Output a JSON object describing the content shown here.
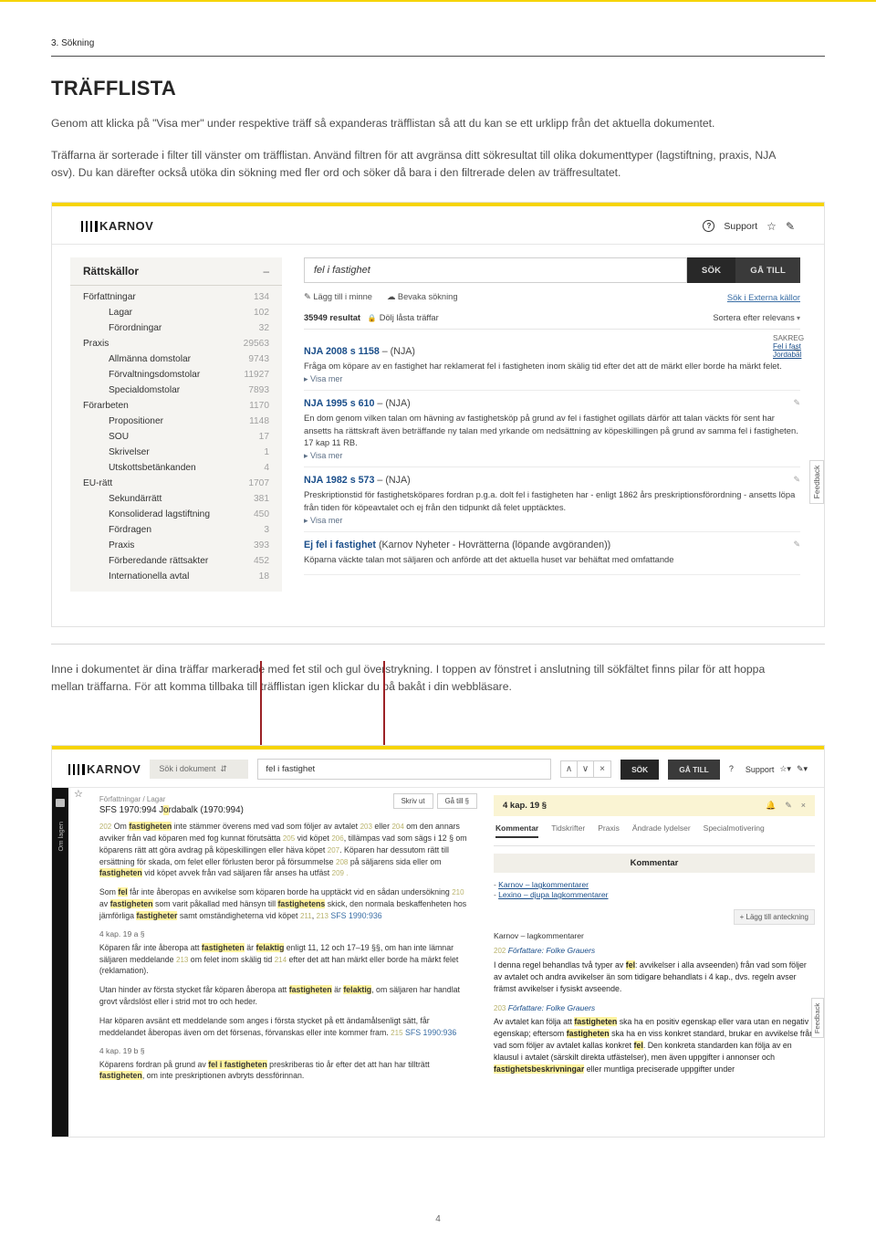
{
  "page": {
    "breadcrumb": "3. Sökning",
    "title": "TRÄFFLISTA",
    "intro1": "Genom att klicka på \"Visa mer\" under respektive träff så expanderas träfflistan så att du kan se ett urklipp från det aktuella dokumentet.",
    "intro2": "Träffarna är sorterade i filter till vänster om träfflistan. Använd filtren för att avgränsa ditt sökresultat till olika dokumenttyper (lagstiftning, praxis, NJA osv). Du kan därefter också utöka din sökning med fler ord och söker då bara i den filtrerade delen av träffresultatet.",
    "intro3": "Inne i dokumentet är dina träffar markerade med fet stil och gul överstrykning. I toppen av fönstret i anslutning till sökfältet finns pilar för att hoppa mellan träffarna. För att komma tillbaka till träfflistan igen klickar du på bakåt i din webbläsare.",
    "page_number": "4"
  },
  "s1": {
    "logo": "KARNOV",
    "support": "Support",
    "side_head": "Rättskällor",
    "side_items": [
      {
        "l": "Författningar",
        "n": "134",
        "sub": false
      },
      {
        "l": "Lagar",
        "n": "102",
        "sub": true
      },
      {
        "l": "Förordningar",
        "n": "32",
        "sub": true
      },
      {
        "l": "Praxis",
        "n": "29563",
        "sub": false
      },
      {
        "l": "Allmänna domstolar",
        "n": "9743",
        "sub": true
      },
      {
        "l": "Förvaltningsdomstolar",
        "n": "11927",
        "sub": true
      },
      {
        "l": "Specialdomstolar",
        "n": "7893",
        "sub": true
      },
      {
        "l": "Förarbeten",
        "n": "1170",
        "sub": false
      },
      {
        "l": "Propositioner",
        "n": "1148",
        "sub": true
      },
      {
        "l": "SOU",
        "n": "17",
        "sub": true
      },
      {
        "l": "Skrivelser",
        "n": "1",
        "sub": true
      },
      {
        "l": "Utskottsbetänkanden",
        "n": "4",
        "sub": true
      },
      {
        "l": "EU-rätt",
        "n": "1707",
        "sub": false
      },
      {
        "l": "Sekundärrätt",
        "n": "381",
        "sub": true
      },
      {
        "l": "Konsoliderad lagstiftning",
        "n": "450",
        "sub": true
      },
      {
        "l": "Fördragen",
        "n": "3",
        "sub": true
      },
      {
        "l": "Praxis",
        "n": "393",
        "sub": true
      },
      {
        "l": "Förberedande rättsakter",
        "n": "452",
        "sub": true
      },
      {
        "l": "Internationella avtal",
        "n": "18",
        "sub": true
      }
    ],
    "query": "fel i fastighet",
    "btn_sok": "SÖK",
    "btn_gatill": "GÅ TILL",
    "link_minne": "Lägg till i minne",
    "link_bevaka": "Bevaka sökning",
    "link_extern": "Sök i Externa källor",
    "result_count": "35949 resultat",
    "hide_locked": "Dölj låsta träffar",
    "sort": "Sortera efter relevans",
    "results": [
      {
        "title": "NJA 2008 s 1158",
        "src": " – (NJA)",
        "snippet": "Fråga om köpare av en fastighet har reklamerat fel i fastigheten inom skälig tid efter det att de märkt eller borde ha märkt felet.",
        "visa": "▸ Visa mer"
      },
      {
        "title": "NJA 1995 s 610",
        "src": " – (NJA)",
        "snippet": "En dom genom vilken talan om hävning av fastighetsköp på grund av fel i fastighet ogillats därför att talan väckts för sent har ansetts ha rättskraft även beträffande ny talan med yrkande om nedsättning av köpeskillingen på grund av samma fel i fastigheten. 17 kap 11 RB.",
        "visa": "▸ Visa mer"
      },
      {
        "title": "NJA 1982 s 573",
        "src": " – (NJA)",
        "snippet": "Preskriptionstid för fastighetsköpares fordran p.g.a. dolt fel i fastigheten har - enligt 1862 års preskriptionsförordning - ansetts löpa från tiden för köpeavtalet och ej från den tidpunkt då felet upptäcktes.",
        "visa": "▸ Visa mer"
      },
      {
        "title": "Ej fel i fastighet",
        "src": " (Karnov Nyheter - Hovrätterna (löpande avgöranden))",
        "snippet": "Köparna väckte talan mot säljaren och anförde att det aktuella huset var behäftat med omfattande",
        "visa": ""
      }
    ],
    "clip": {
      "a": "SAKREG",
      "b": "Fel i fast",
      "c": "Jordabal"
    },
    "feedback": "Feedback"
  },
  "s2": {
    "logo": "KARNOV",
    "search_label": "Sök i dokument",
    "query": "fel i fastighet",
    "btn_sok": "SÖK",
    "btn_gatill": "GÅ TILL",
    "support": "Support",
    "rail_label": "Om lagen",
    "crumbs": "Författningar  /  Lagar",
    "doc_title_pre": "SFS 1970:994 J",
    "doc_title_hl": "o",
    "doc_title_post": "rdabalk (1970:994)",
    "btn_skriv": "Skriv ut",
    "btn_gas": "Gå till §",
    "para1_a": "Om ",
    "para1_b": "fastigheten",
    "para1_c": " inte stämmer överens med vad som följer av avtalet ",
    "para1_d": " eller ",
    "para1_e": " om den annars avviker från vad köparen med fog kunnat förutsätta ",
    "para1_f": " vid köpet ",
    "para1_g": ", tillämpas vad som sägs i 12 § om köparens rätt att göra avdrag på köpeskillingen eller häva köpet ",
    "para1_h": ". Köparen har dessutom rätt till ersättning för skada, om felet eller förlusten beror på försummelse ",
    "para1_i": " på säljarens sida eller om ",
    "para1_j": "fastigheten",
    "para1_k": " vid köpet avvek från vad säljaren får anses ha utfäst ",
    "idx202": "202",
    "idx203": "203",
    "idx204": "204",
    "idx205": "205",
    "idx206": "206",
    "idx207": "207",
    "idx208": "208",
    "idx209": "209 .",
    "idx210": "210",
    "idx211": "211",
    "idx213": "213",
    "idx214": "214",
    "idx215": "215",
    "para2_a": "Som ",
    "para2_b": "fel",
    "para2_c": " får inte åberopas en avvikelse som köparen borde ha upptäckt vid en sådan undersökning ",
    "para2_d": " av ",
    "para2_e": "fastigheten",
    "para2_f": " som varit påkallad med hänsyn till ",
    "para2_g": "fastighetens",
    "para2_h": " skick, den normala beskaffenheten hos jämförliga ",
    "para2_i": "fastigheter",
    "para2_j": " samt omständigheterna vid köpet ",
    "para2_k": ", ",
    "para2_l": " SFS 1990:936",
    "head19a": "4 kap. 19 a §",
    "para3_a": "Köparen får inte åberopa att ",
    "para3_b": "fastigheten",
    "para3_c": " är ",
    "para3_d": "felaktig",
    "para3_e": " enligt 11, 12 och 17–19 §§, om han inte lämnar säljaren meddelande ",
    "para3_f": " om felet inom skälig tid ",
    "para3_g": " efter det att han märkt eller borde ha märkt felet (reklamation).",
    "para4_a": "Utan hinder av första stycket får köparen åberopa att ",
    "para4_b": "fastigheten",
    "para4_c": " är ",
    "para4_d": "felaktig",
    "para4_e": ", om säljaren har handlat grovt vårdslöst eller i strid mot tro och heder.",
    "para5_a": "Har köparen avsänt ett meddelande som anges i första stycket på ett ändamålsenligt sätt, får meddelandet åberopas även om det försenas, förvanskas eller inte kommer fram. ",
    "para5_b": " SFS 1990:936",
    "head19b": "4 kap. 19 b §",
    "para6_a": "Köparens fordran på grund av ",
    "para6_b": "fel i fastigheten",
    "para6_c": " preskriberas tio år efter det att han har tillträtt ",
    "para6_d": "fastigheten",
    "para6_e": ", om inte preskriptionen avbryts dessförinnan. ",
    "right": {
      "chapter": "4 kap. 19 §",
      "tabs": [
        "Kommentar",
        "Tidskrifter",
        "Praxis",
        "Ändrade lydelser",
        "Specialmotivering"
      ],
      "k_head": "Kommentar",
      "link1": "Karnov – lagkommentarer",
      "link2": "Lexino – djupa lagkommentarer",
      "note": "+ Lägg till anteckning",
      "karnov_title": "Karnov – lagkommentarer",
      "auth": "Författare: Folke Grauers",
      "c1_a": "I denna regel behandlas två typer av ",
      "c1_b": "fel",
      "c1_c": ": avvikelser i alla avseenden) från vad som följer av avtalet och andra avvikelser än som tidigare behandlats i 4 kap., dvs. regeln avser främst avvikelser i fysiskt avseende.",
      "c2_a": "Av avtalet kan följa att ",
      "c2_b": "fastigheten",
      "c2_c": " ska ha en positiv egenskap eller vara utan en negativ egenskap; eftersom ",
      "c2_d": "fastigheten",
      "c2_e": " ska ha en viss konkret standard, brukar en avvikelse från vad som följer av avtalet kallas konkret ",
      "c2_f": "fel",
      "c2_g": ". Den konkreta standarden kan följa av en klausul i avtalet (särskilt direkta utfästelser), men även uppgifter i annonser och ",
      "c2_h": "fastighetsbeskrivningar",
      "c2_i": " eller muntliga preciserade uppgifter under",
      "idx202": "202",
      "idx203": "203"
    },
    "feedback": "Feedback"
  }
}
